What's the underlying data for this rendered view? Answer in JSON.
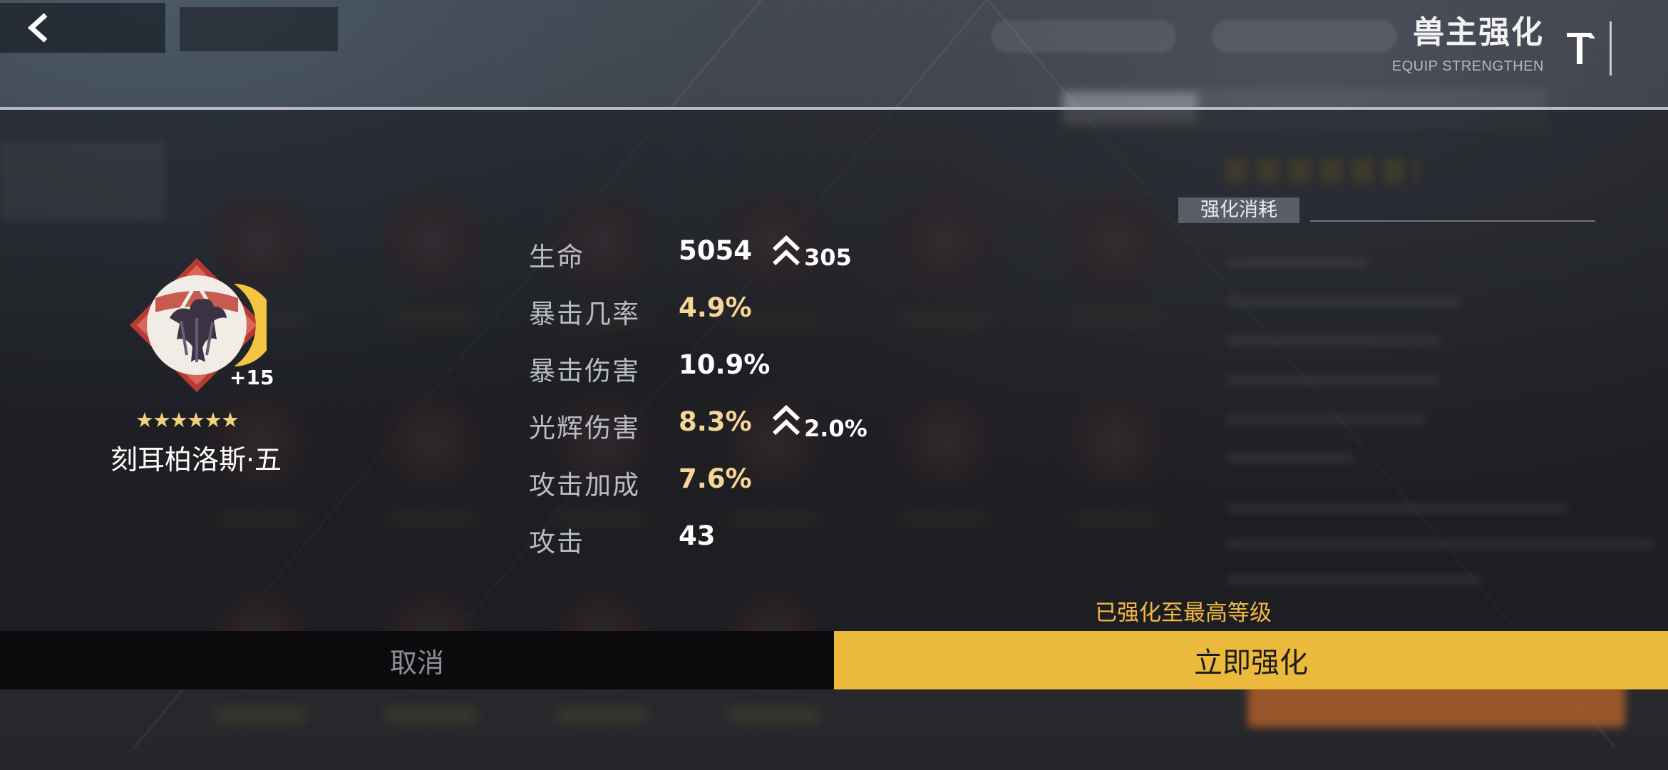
{
  "header": {
    "title": "兽主强化",
    "subtitle": "EQUIP STRENGTHEN"
  },
  "item": {
    "level": "+15",
    "stars": "★★★★★★",
    "star_count": 6,
    "name": "刻耳柏洛斯·五"
  },
  "stats": [
    {
      "label": "生命",
      "value": "5054",
      "increase": "305"
    },
    {
      "label": "暴击几率",
      "value": "4.9%",
      "increase": ""
    },
    {
      "label": "暴击伤害",
      "value": "10.9%",
      "increase": ""
    },
    {
      "label": "光辉伤害",
      "value": "8.3%",
      "increase": "2.0%"
    },
    {
      "label": "攻击加成",
      "value": "7.6%",
      "increase": ""
    },
    {
      "label": "攻击",
      "value": "43",
      "increase": ""
    }
  ],
  "cost": {
    "label": "强化消耗"
  },
  "status": {
    "max_level_note": "已强化至最高等级"
  },
  "buttons": {
    "cancel": "取消",
    "confirm": "立即强化"
  },
  "colors": {
    "accent_gold": "#ebba3c",
    "stat_gold": "#f5d697",
    "note_orange": "#f2b741"
  },
  "icons": {
    "back": "chevron-left-icon",
    "hammer": "hammer-icon",
    "increase": "double-chevron-up-icon"
  }
}
